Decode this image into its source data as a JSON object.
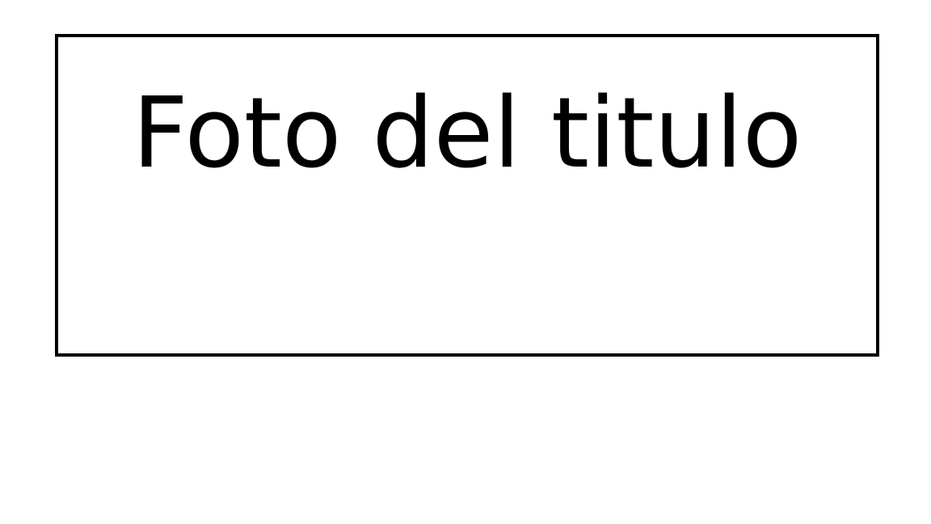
{
  "slide": {
    "title": "Foto del titulo",
    "frame_border_color": "#000000",
    "background_color": "#ffffff"
  }
}
